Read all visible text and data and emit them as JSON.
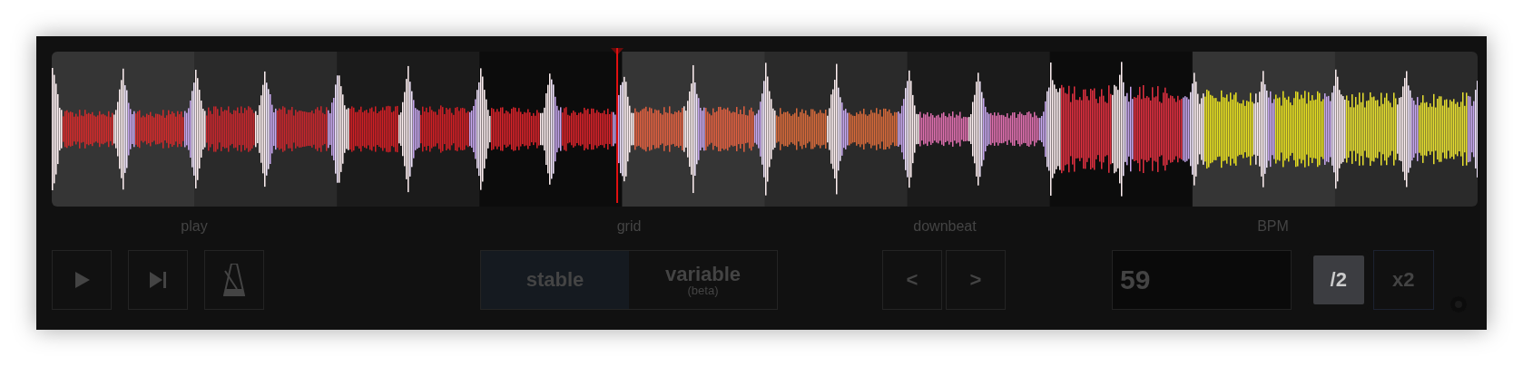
{
  "sections": [
    {
      "kind": "play",
      "label": "play",
      "buttons": [
        {
          "kind": "play"
        },
        {
          "kind": "skip"
        },
        {
          "kind": "metronome"
        }
      ]
    },
    {
      "kind": "grid",
      "label": "grid",
      "options": [
        {
          "label": "stable",
          "selected": true
        },
        {
          "label": "variable",
          "note": "(beta)",
          "selected": false
        }
      ]
    },
    {
      "kind": "downbeat",
      "label": "downbeat",
      "buttons": [
        {
          "text": "<"
        },
        {
          "text": ">"
        }
      ]
    },
    {
      "kind": "bpm",
      "label": "BPM",
      "value": "59",
      "buttons": [
        {
          "text": "/2",
          "selected": true
        },
        {
          "text": "x2",
          "selected": false
        }
      ]
    }
  ]
}
